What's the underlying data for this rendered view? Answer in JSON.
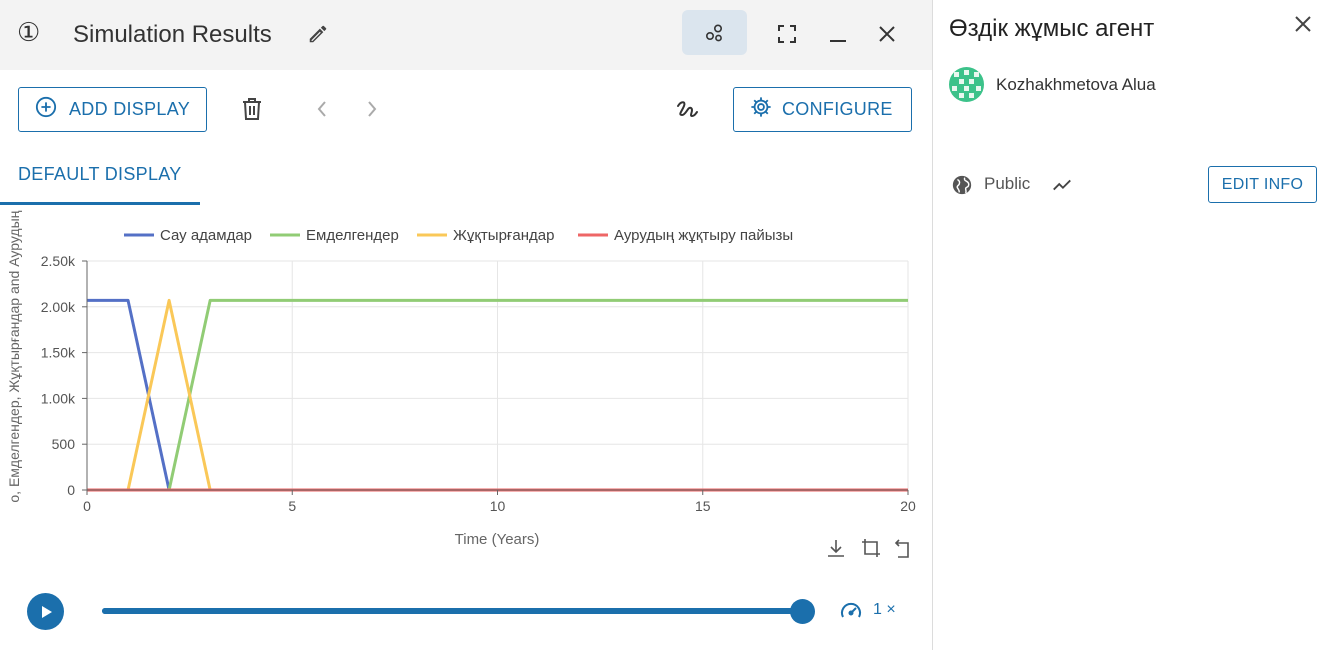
{
  "window": {
    "step_number": "①",
    "title": "Simulation Results"
  },
  "toolbar": {
    "add_display_label": "ADD DISPLAY",
    "configure_label": "CONFIGURE"
  },
  "tabs": [
    {
      "label": "DEFAULT DISPLAY",
      "active": true
    }
  ],
  "player": {
    "progress_fraction": 1.0,
    "speed_label": "1 ×"
  },
  "agent_panel": {
    "title": "Өздік жұмыс агент",
    "owner": "Kozhakhmetova Alua",
    "visibility": "Public",
    "edit_info_label": "EDIT INFO"
  },
  "colors": {
    "accent": "#1b6fac",
    "titlebar_bg": "#f3f3f3",
    "toggle_bg": "#dbe5ee"
  },
  "icons": {
    "pencil": "pencil-icon",
    "sim_toggle": "scatter-nodes-icon",
    "fullscreen": "fullscreen-icon",
    "minimize": "minimize-icon",
    "close": "close-icon",
    "add": "plus-circle-icon",
    "trash": "trash-icon",
    "prev": "chevron-left-icon",
    "next": "chevron-right-icon",
    "sketch": "squiggle-icon",
    "configure": "gear-icon",
    "play": "play-icon",
    "speed": "speedometer-icon",
    "globe": "globe-icon",
    "trend": "trend-icon",
    "download": "download-icon",
    "crop": "crop-icon",
    "reset": "reset-icon"
  },
  "chart_data": {
    "type": "line",
    "xlabel": "Time (Years)",
    "ylabel": "о, Емделгендер, Жұқтырғандар and Аурудың ж",
    "xlim": [
      0,
      20
    ],
    "ylim": [
      0,
      2500
    ],
    "x_ticks": [
      0,
      5,
      10,
      15,
      20
    ],
    "y_ticks": [
      0,
      500,
      1000,
      1500,
      2000,
      2500
    ],
    "y_tick_labels": [
      "0",
      "500",
      "1.00k",
      "1.50k",
      "2.00k",
      "2.50k"
    ],
    "grid": true,
    "legend_position": "top",
    "series": [
      {
        "name": "Сау адамдар",
        "color": "#5470c6",
        "x": [
          0,
          1,
          2,
          3,
          20
        ],
        "y": [
          2070,
          2070,
          0,
          0,
          0
        ]
      },
      {
        "name": "Емделгендер",
        "color": "#91cc75",
        "x": [
          0,
          2,
          3,
          20
        ],
        "y": [
          0,
          0,
          2070,
          2070
        ]
      },
      {
        "name": "Жұқтырғандар",
        "color": "#fac858",
        "x": [
          0,
          1,
          2,
          3,
          20
        ],
        "y": [
          0,
          0,
          2070,
          0,
          0
        ]
      },
      {
        "name": "Аурудың жұқтыру пайызы",
        "color": "#ee6666",
        "x": [
          0,
          20
        ],
        "y": [
          0,
          0
        ]
      }
    ]
  }
}
